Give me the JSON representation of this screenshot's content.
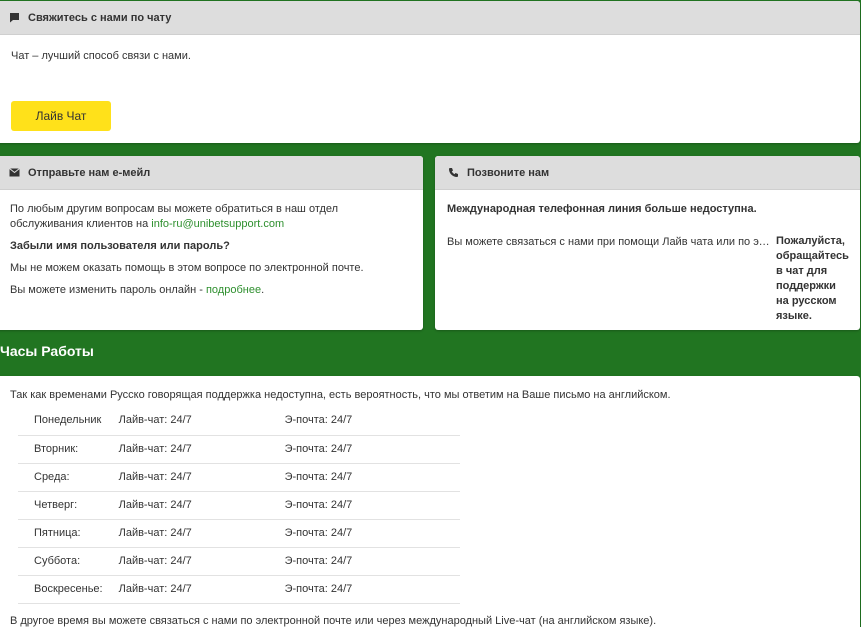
{
  "chat": {
    "title": "Свяжитесь с нами по чату",
    "icon": "chat-bubble-icon",
    "text": "Чат – лучший способ связи с нами.",
    "button_label": "Лайв Чат"
  },
  "email": {
    "title": "Отправьте нам е-мейл",
    "icon": "envelope-icon",
    "intro_prefix": "По любым другим вопросам вы можете обратиться в наш отдел обслуживания клиентов на ",
    "email_link": "info-ru@unibetsupport.com",
    "forgot_heading": "Забыли имя пользователя или пароль?",
    "forgot_text": "Мы не можем оказать помощь в этом вопросе по электронной почте.",
    "reset_prefix": "Вы можете изменить пароль онлайн - ",
    "reset_link": "подробнее",
    "reset_suffix": "."
  },
  "phone": {
    "title": "Позвоните нам",
    "icon": "phone-icon",
    "heading": "Международная телефонная линия больше недоступна.",
    "text": "Вы можете связаться с нами при помощи Лайв чата или по электронной почте",
    "note": "Пожалуйста, обращайтесь в чат для поддержки на русском языке."
  },
  "hours": {
    "title": "Часы Работы",
    "intro": "Так как временами Русско говорящая поддержка недоступна, есть вероятность, что мы ответим на Ваше письмо на английском.",
    "rows": [
      {
        "day": "Понедельник",
        "live": "Лайв-чат: 24/7",
        "email": "Э-почта: 24/7"
      },
      {
        "day": "Вторник:",
        "live": "Лайв-чат: 24/7",
        "email": "Э-почта: 24/7"
      },
      {
        "day": "Среда:",
        "live": "Лайв-чат: 24/7",
        "email": "Э-почта: 24/7"
      },
      {
        "day": "Четверг:",
        "live": "Лайв-чат: 24/7",
        "email": "Э-почта: 24/7"
      },
      {
        "day": "Пятница:",
        "live": "Лайв-чат: 24/7",
        "email": "Э-почта: 24/7"
      },
      {
        "day": "Суббота:",
        "live": "Лайв-чат: 24/7",
        "email": "Э-почта: 24/7"
      },
      {
        "day": "Воскресенье:",
        "live": "Лайв-чат: 24/7",
        "email": "Э-почта: 24/7"
      }
    ],
    "footer": "В другое время вы можете связаться с нами по электронной почте или через международный Live-чат (на английском языке)."
  },
  "colors": {
    "background": "#217521",
    "header_bar": "#dddddd",
    "button": "#ffe11a",
    "link": "#2e8f2e"
  }
}
